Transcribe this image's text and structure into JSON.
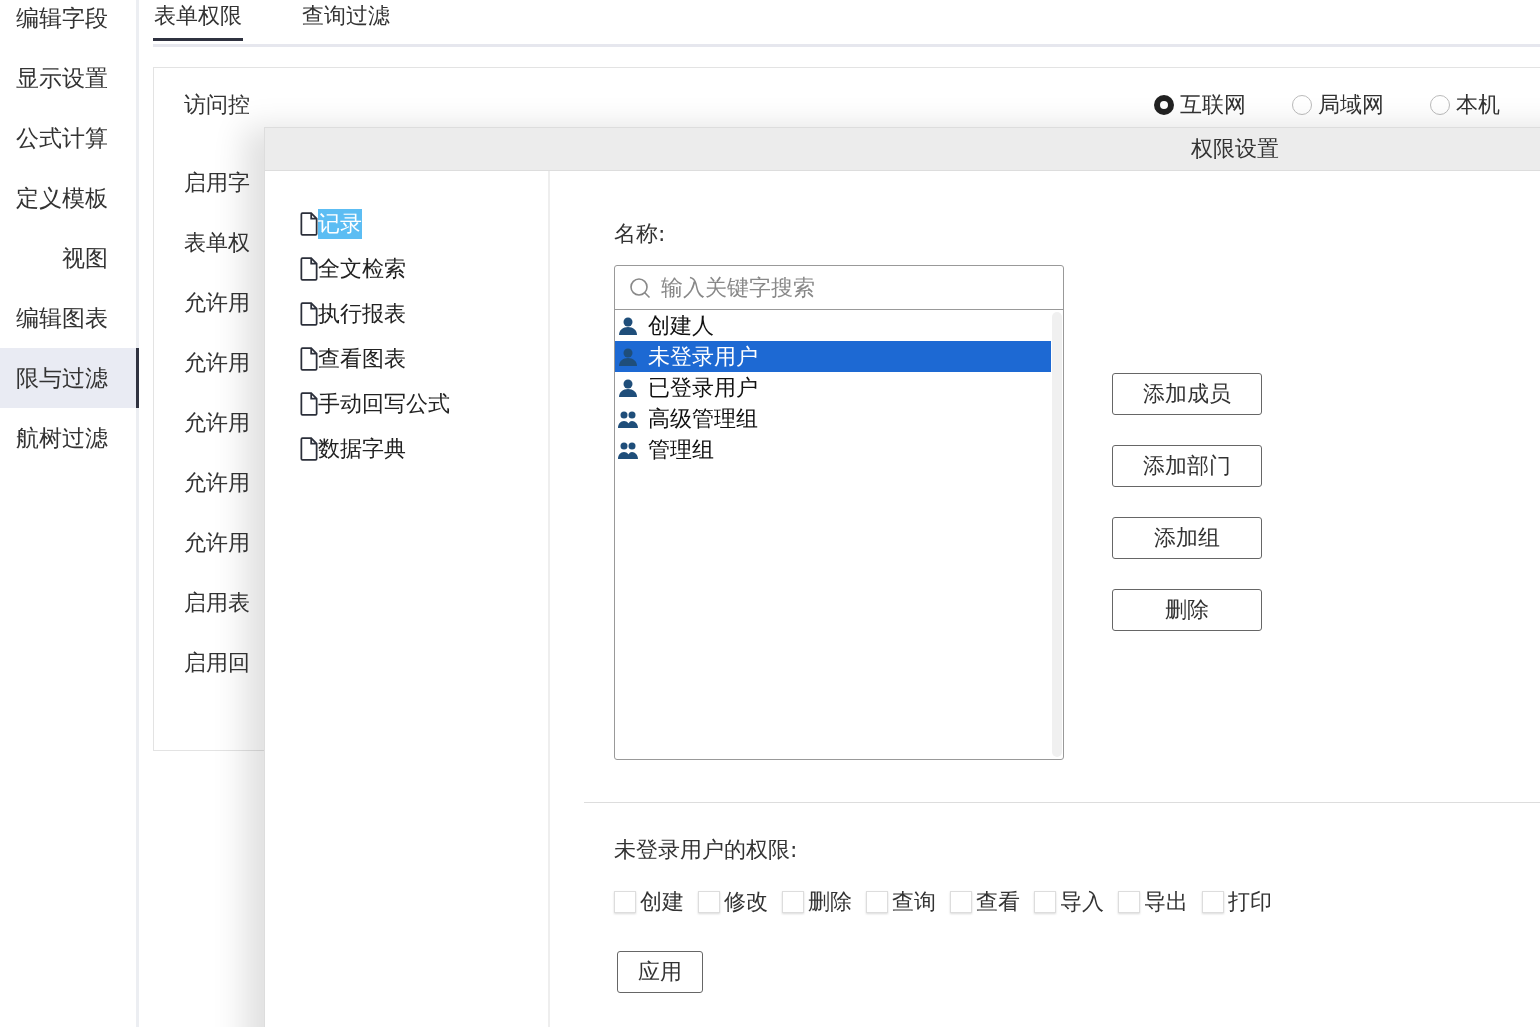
{
  "sidebar": {
    "items": [
      {
        "label": "编辑字段",
        "selected": false
      },
      {
        "label": "显示设置",
        "selected": false
      },
      {
        "label": "公式计算",
        "selected": false
      },
      {
        "label": "定义模板",
        "selected": false
      },
      {
        "label": "视图",
        "selected": false
      },
      {
        "label": "编辑图表",
        "selected": false
      },
      {
        "label": "限与过滤",
        "selected": true
      },
      {
        "label": "航树过滤",
        "selected": false
      }
    ]
  },
  "tabs": [
    {
      "label": "表单权限",
      "selected": true
    },
    {
      "label": "查询过滤",
      "selected": false
    }
  ],
  "form": {
    "rows": [
      "访问控",
      "启用字",
      "表单权",
      "允许用",
      "允许用",
      "允许用",
      "允许用",
      "允许用",
      "启用表",
      "启用回"
    ],
    "access_options": [
      {
        "label": "互联网",
        "selected": true
      },
      {
        "label": "局域网",
        "selected": false
      },
      {
        "label": "本机",
        "selected": false
      }
    ]
  },
  "dialog": {
    "title": "权限设置",
    "tree": [
      {
        "label": "记录",
        "selected": true
      },
      {
        "label": "全文检索",
        "selected": false
      },
      {
        "label": "执行报表",
        "selected": false
      },
      {
        "label": "查看图表",
        "selected": false
      },
      {
        "label": "手动回写公式",
        "selected": false
      },
      {
        "label": "数据字典",
        "selected": false
      }
    ],
    "name_label": "名称:",
    "search": {
      "placeholder": "输入关键字搜索"
    },
    "members": [
      {
        "label": "创建人",
        "kind": "user",
        "selected": false
      },
      {
        "label": "未登录用户",
        "kind": "user",
        "selected": true
      },
      {
        "label": "已登录用户",
        "kind": "user",
        "selected": false
      },
      {
        "label": "高级管理组",
        "kind": "group",
        "selected": false
      },
      {
        "label": "管理组",
        "kind": "group",
        "selected": false
      }
    ],
    "buttons": [
      "添加成员",
      "添加部门",
      "添加组",
      "删除"
    ],
    "permissions_title": "未登录用户的权限:",
    "permissions": [
      {
        "label": "创建",
        "checked": false
      },
      {
        "label": "修改",
        "checked": false
      },
      {
        "label": "删除",
        "checked": false
      },
      {
        "label": "查询",
        "checked": false
      },
      {
        "label": "查看",
        "checked": false
      },
      {
        "label": "导入",
        "checked": false
      },
      {
        "label": "导出",
        "checked": false
      },
      {
        "label": "打印",
        "checked": false
      }
    ],
    "apply": "应用"
  }
}
